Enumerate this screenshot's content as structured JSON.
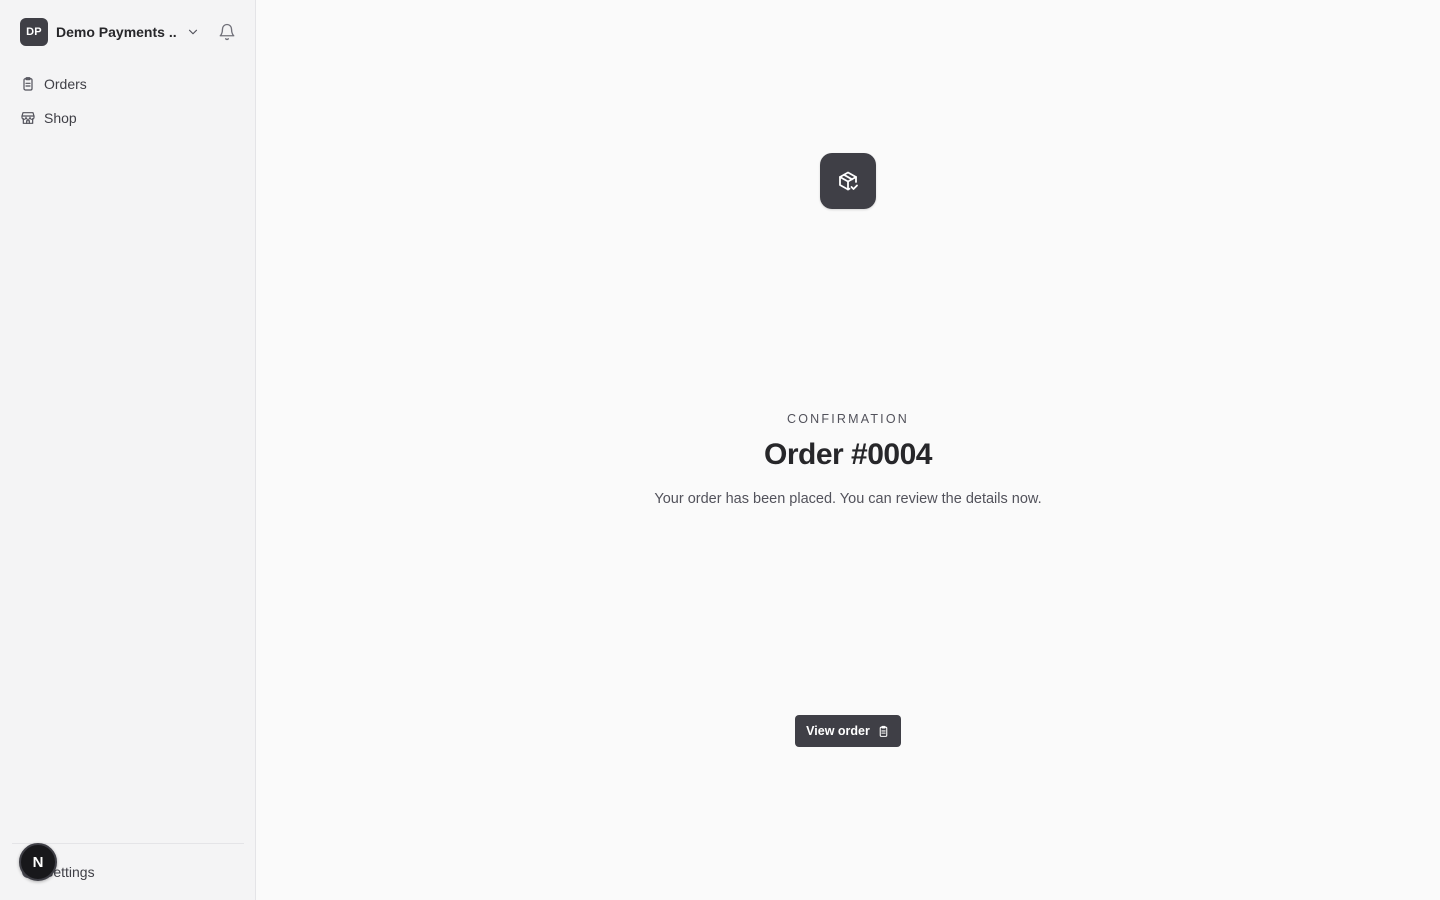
{
  "sidebar": {
    "org": {
      "initials": "DP",
      "name": "Demo Payments ..."
    },
    "nav": [
      {
        "label": "Orders",
        "icon": "clipboard-icon"
      },
      {
        "label": "Shop",
        "icon": "store-icon"
      }
    ],
    "settings_label": "Settings",
    "user_initial": "N"
  },
  "main": {
    "eyebrow": "CONFIRMATION",
    "title": "Order #0004",
    "subtitle": "Your order has been placed. You can review the details now.",
    "view_button_label": "View order",
    "hero_icon": "package-check-icon"
  },
  "colors": {
    "accent": "#3f3f46",
    "background": "#fafafa",
    "sidebar": "#f4f4f5"
  }
}
